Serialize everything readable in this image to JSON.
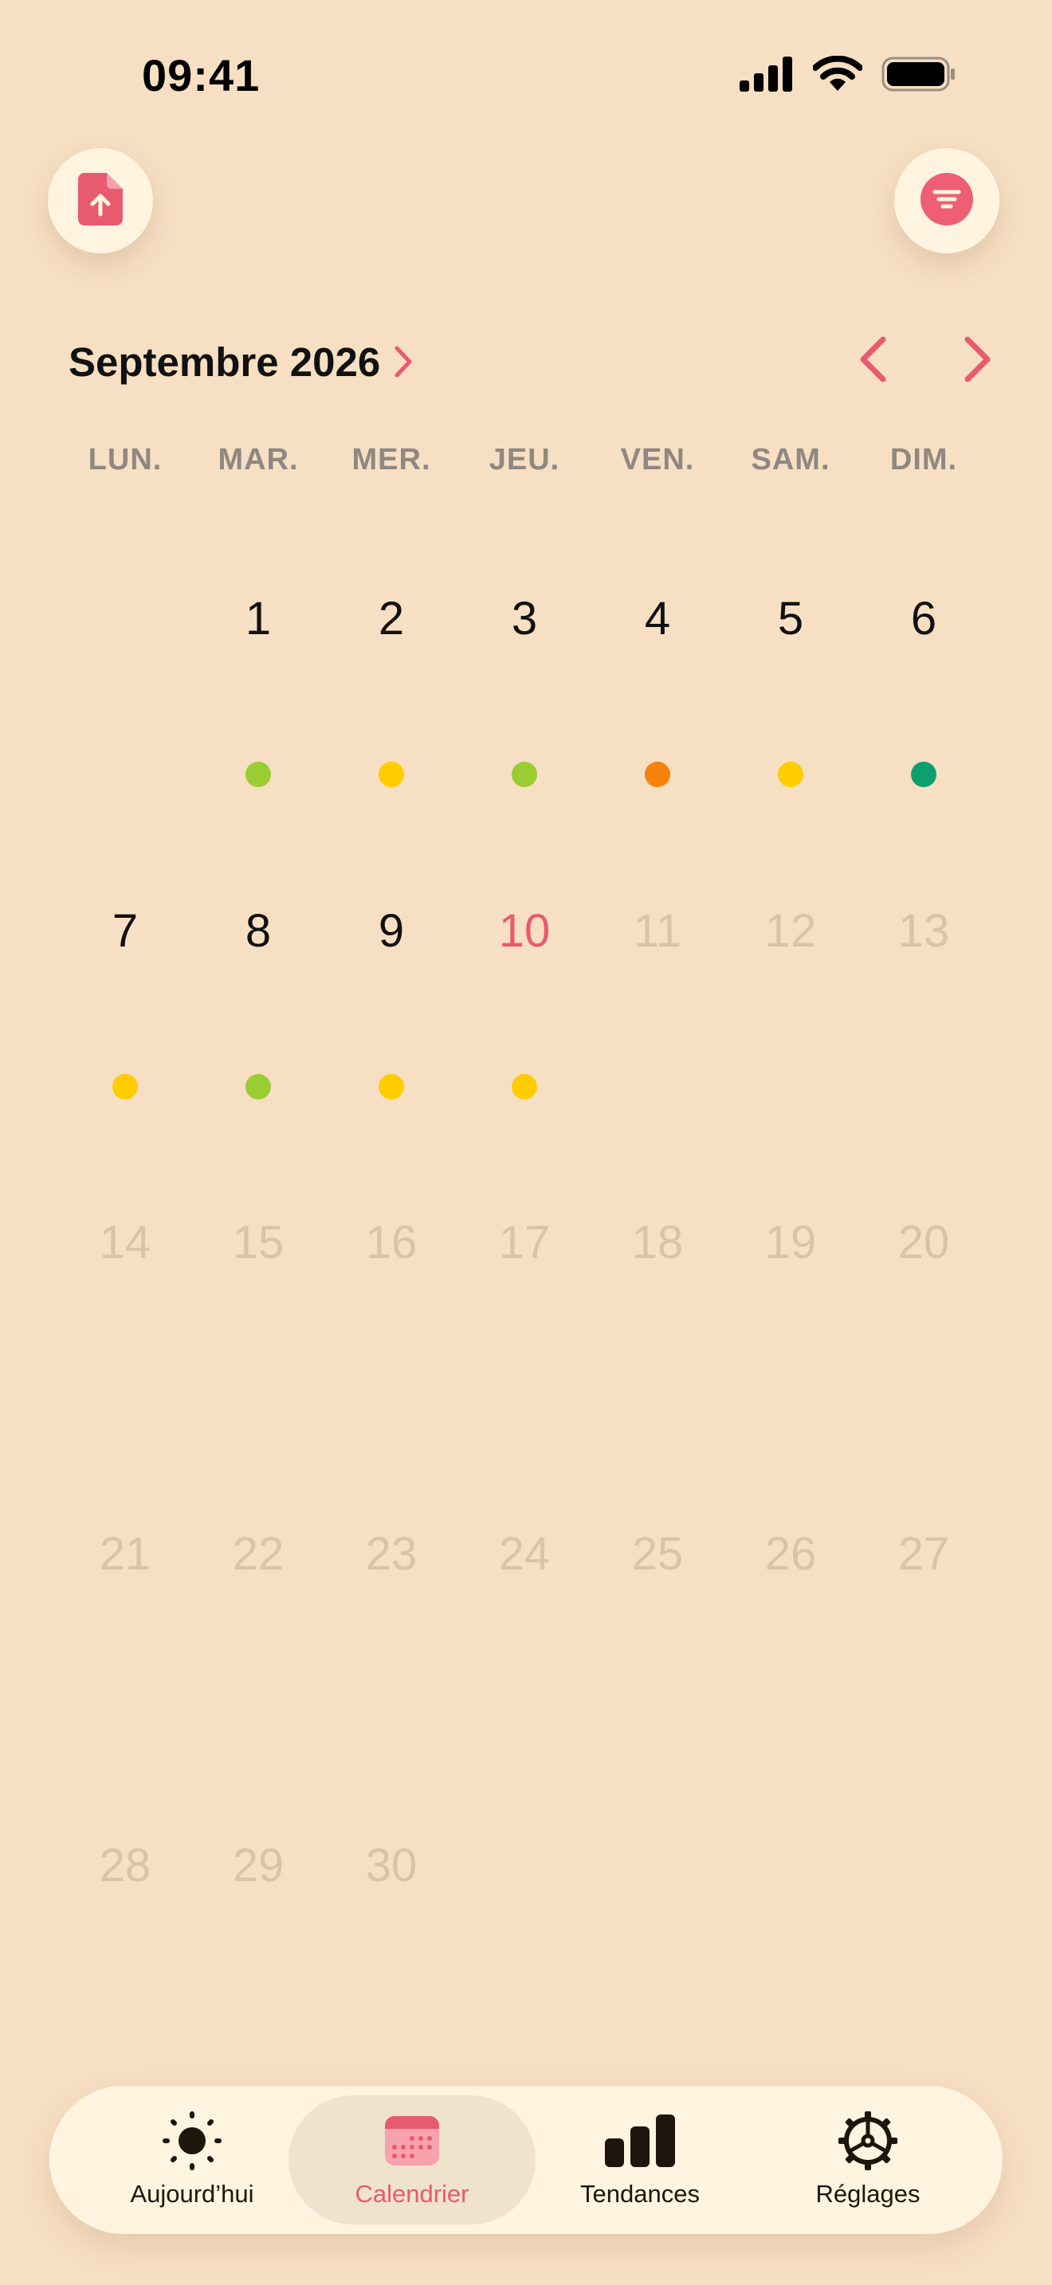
{
  "status_bar": {
    "time": "09:41"
  },
  "header": {
    "export_icon": "file-upload-icon",
    "filter_icon": "filter-icon",
    "month_title": "Septembre 2026",
    "accent": "#E85A6E"
  },
  "weekdays": [
    "LUN.",
    "MAR.",
    "MER.",
    "JEU.",
    "VEN.",
    "SAM.",
    "DIM."
  ],
  "calendar": {
    "today": 10,
    "weeks": [
      [
        "",
        "1",
        "2",
        "3",
        "4",
        "5",
        "6"
      ],
      [
        "7",
        "8",
        "9",
        "10",
        "11",
        "12",
        "13"
      ],
      [
        "14",
        "15",
        "16",
        "17",
        "18",
        "19",
        "20"
      ],
      [
        "21",
        "22",
        "23",
        "24",
        "25",
        "26",
        "27"
      ],
      [
        "28",
        "29",
        "30",
        "",
        "",
        "",
        ""
      ]
    ],
    "day_indicators": {
      "1": "#9ACD32",
      "2": "#FFCC00",
      "3": "#9ACD32",
      "4": "#F5820D",
      "5": "#FFCC00",
      "6": "#0E9F6E",
      "7": "#FFCC00",
      "8": "#9ACD32",
      "9": "#FFCC00",
      "10": "#FFCC00"
    }
  },
  "tab_bar": {
    "tabs": [
      {
        "label": "Aujourd’hui",
        "icon": "sun-icon",
        "active": false
      },
      {
        "label": "Calendrier",
        "icon": "calendar-icon",
        "active": true
      },
      {
        "label": "Tendances",
        "icon": "bar-chart-icon",
        "active": false
      },
      {
        "label": "Réglages",
        "icon": "gear-icon",
        "active": false
      }
    ]
  }
}
